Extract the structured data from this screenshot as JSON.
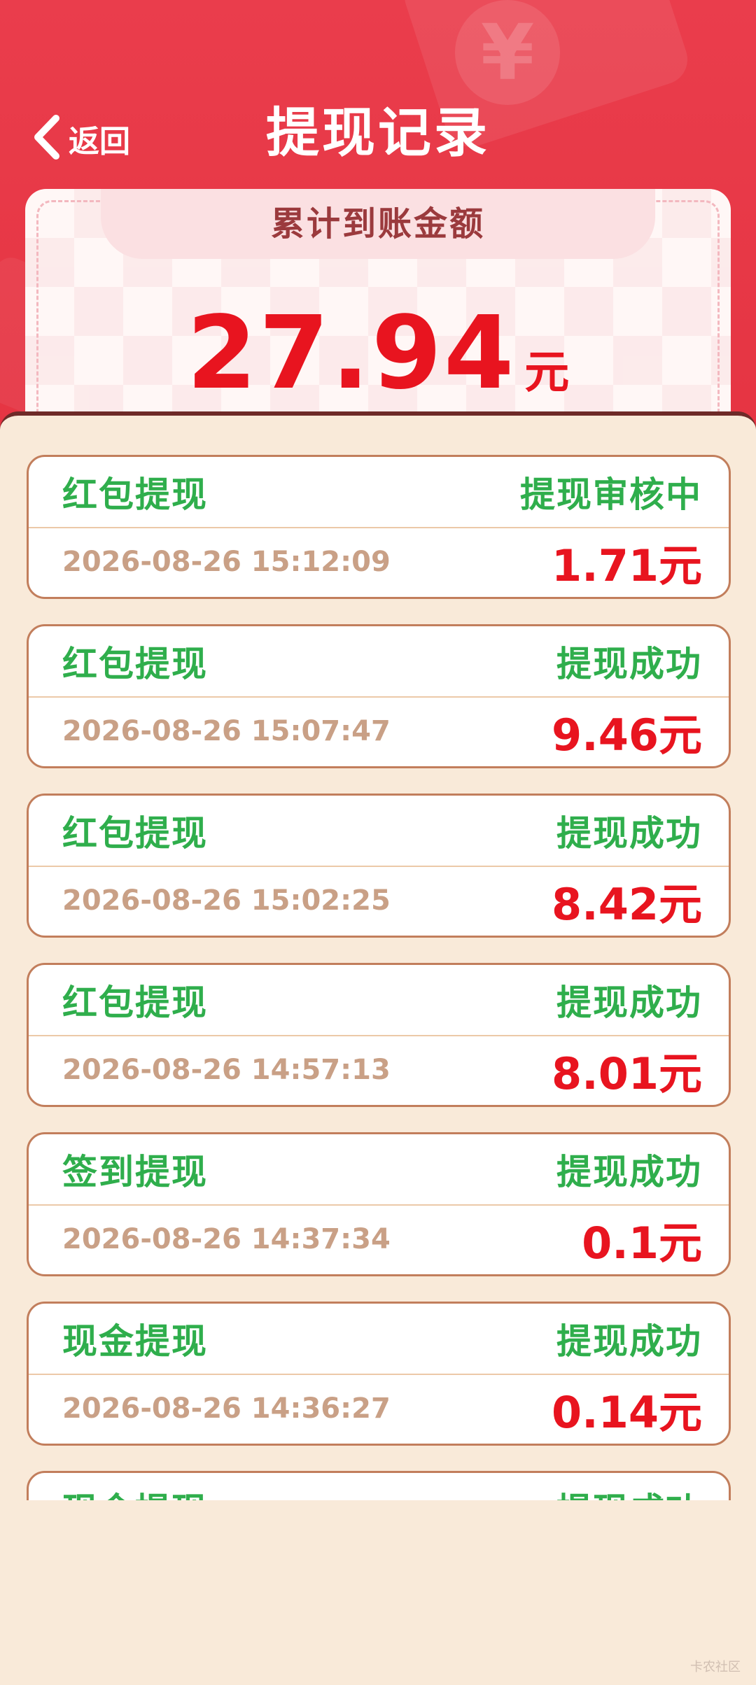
{
  "header": {
    "back_label": "返回",
    "title": "提现记录"
  },
  "summary": {
    "label": "累计到账金额",
    "amount": "27.94",
    "unit": "元"
  },
  "records": [
    {
      "type": "红包提现",
      "status": "提现审核中",
      "time": "2026-08-26 15:12:09",
      "amount": "1.71元"
    },
    {
      "type": "红包提现",
      "status": "提现成功",
      "time": "2026-08-26 15:07:47",
      "amount": "9.46元"
    },
    {
      "type": "红包提现",
      "status": "提现成功",
      "time": "2026-08-26 15:02:25",
      "amount": "8.42元"
    },
    {
      "type": "红包提现",
      "status": "提现成功",
      "time": "2026-08-26 14:57:13",
      "amount": "8.01元"
    },
    {
      "type": "签到提现",
      "status": "提现成功",
      "time": "2026-08-26 14:37:34",
      "amount": "0.1元"
    },
    {
      "type": "现金提现",
      "status": "提现成功",
      "time": "2026-08-26 14:36:27",
      "amount": "0.14元"
    },
    {
      "type": "现金提现",
      "status": "提现成功",
      "time": "",
      "amount": ""
    }
  ],
  "colors": {
    "header_red": "#e53442",
    "amount_red": "#e8141f",
    "status_green": "#2fae4c",
    "time_tan": "#c9a086",
    "panel_bg": "#f9ead9"
  },
  "watermark": "卡农社区"
}
